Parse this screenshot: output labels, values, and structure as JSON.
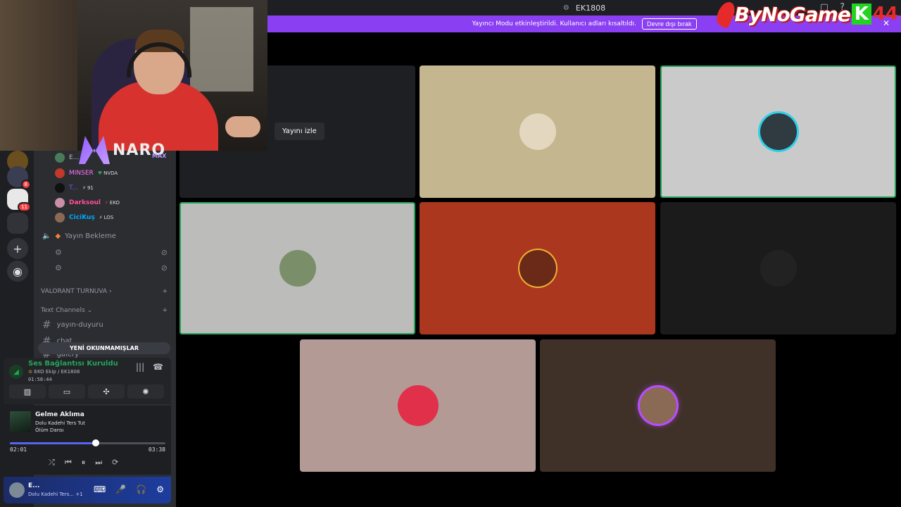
{
  "window": {
    "server_title": "EK1808"
  },
  "banner": {
    "message": "Yayıncı Modu etkinleştirildi. Kullanıcı adları kısaltıldı.",
    "button_label": "Devre dışı bırak",
    "close_icon": "close-icon"
  },
  "brand": {
    "name": "ByNoGame",
    "k": "K",
    "number": "44"
  },
  "webcam_overlay": {
    "logo_text": "NARO",
    "logo_sub": "MAX"
  },
  "rail": {
    "items": [
      {
        "icon": "server-icon",
        "badge": "8"
      },
      {
        "icon": "server-icon",
        "badge": "11"
      },
      {
        "icon": "folder-icon",
        "badge": ""
      },
      {
        "icon": "add-server-icon",
        "badge": ""
      },
      {
        "icon": "discover-icon",
        "badge": ""
      }
    ]
  },
  "sidebar": {
    "voice_users": [
      {
        "name": "E...",
        "color": "#23a55a",
        "tag": "E"
      },
      {
        "name": "MINSER",
        "color": "#ff73fa",
        "tag": "NVDA"
      },
      {
        "name": "T...",
        "color": "#949ba4",
        "tag": "91"
      },
      {
        "name": "Darksoul",
        "color": "#ff4f9a",
        "tag": "EKO"
      },
      {
        "name": "CiciKuş",
        "color": "#00a8fc",
        "tag": "LOS"
      }
    ],
    "voice_channel": "Yayın Bekleme",
    "category_1": "VALORANT TURNUVA",
    "category_2": "Text Channels",
    "text_channels": [
      "yayın-duyuru",
      "chat",
      "galery"
    ],
    "unread_pill": "YENİ OKUNMAMIŞLAR"
  },
  "voice_panel": {
    "status": "Ses Bağlantısı Kuruldu",
    "channel": "EKO Ekip / EK1808",
    "elapsed": "01:58:44"
  },
  "music": {
    "song": "Gelme Aklıma",
    "artist": "Dolu Kadehi Ters Tut",
    "album": "Ölüm Dansı",
    "current_time": "02:01",
    "total_time": "03:38",
    "progress": 0.55
  },
  "user_area": {
    "name": "E...",
    "status": "Dolu Kadehi Ters...",
    "extra": "+1"
  },
  "stage": {
    "watch_button": "Yayını izle",
    "tiles": [
      {
        "bg": "#1e1f22",
        "avatar": "",
        "speaking": false
      },
      {
        "bg": "#c4b78f",
        "avatar": "#e3d7c0",
        "speaking": false
      },
      {
        "bg": "#cacaca",
        "avatar": "#2f3b40",
        "speaking": true
      },
      {
        "bg": "#bcbcba",
        "avatar": "#7b8e6a",
        "speaking": true
      },
      {
        "bg": "#ab371e",
        "avatar": "#6b2a18",
        "speaking": false
      },
      {
        "bg": "#1b1b1b",
        "avatar": "#222",
        "speaking": false
      },
      {
        "bg": "#b39a95",
        "avatar": "#e0304a",
        "speaking": false
      },
      {
        "bg": "#3f3128",
        "avatar": "#8a6a55",
        "speaking": false
      }
    ]
  }
}
